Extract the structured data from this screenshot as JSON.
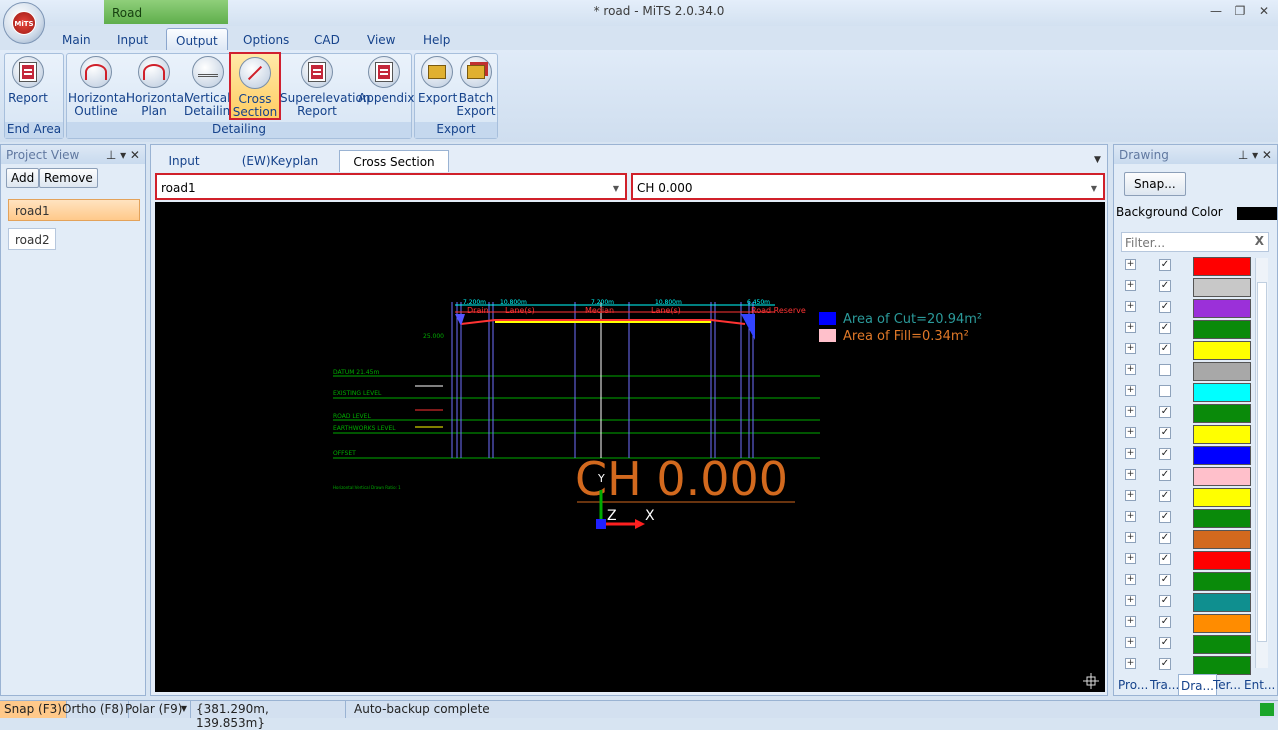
{
  "window": {
    "context_tab": "Road",
    "title": "* road - MiTS 2.0.34.0",
    "logo_text": "MiTS"
  },
  "menu": [
    "Main",
    "Input",
    "Output",
    "Options",
    "CAD",
    "View",
    "Help"
  ],
  "ribbon": {
    "groups": [
      "End Area",
      "Detailing",
      "Export"
    ],
    "buttons": [
      {
        "l1": "Report",
        "l2": ""
      },
      {
        "l1": "Horizontal",
        "l2": "Outline"
      },
      {
        "l1": "Horizontal",
        "l2": "Plan"
      },
      {
        "l1": "Vertical",
        "l2": "Detailing"
      },
      {
        "l1": "Cross",
        "l2": "Section"
      },
      {
        "l1": "Superelevation",
        "l2": "Report"
      },
      {
        "l1": "Appendix",
        "l2": ""
      },
      {
        "l1": "Export",
        "l2": ""
      },
      {
        "l1": "Batch",
        "l2": "Export"
      }
    ]
  },
  "project_view": {
    "title": "Project View",
    "add": "Add",
    "remove": "Remove",
    "items": [
      "road1",
      "road2"
    ]
  },
  "tabs": [
    "Input",
    "(EW)Keyplan",
    "Cross Section"
  ],
  "road_select": "road1",
  "chainage_select": "CH 0.000",
  "canvas": {
    "area_cut": "Area of Cut=20.94m²",
    "area_fill": "Area of Fill=0.34m²",
    "chainage": "CH 0.000",
    "datum": "DATUM 21.45m",
    "row_labels": [
      "EXISTING LEVEL",
      "ROAD LEVEL",
      "EARTHWORKS LEVEL",
      "OFFSET"
    ],
    "ratio": "Horizontal:Vertical Drawn Ratio: 1",
    "elev": "25.000",
    "dims": [
      "7.200m",
      "10.800m",
      "7.200m",
      "10.800m",
      "6.450m"
    ],
    "zones": [
      "Drain",
      "Lane(s)",
      "Median",
      "Lane(s)",
      "Road Reserve"
    ],
    "axis_y": "Y",
    "axis_z": "Z",
    "axis_x": "X"
  },
  "drawing": {
    "title": "Drawing",
    "snap": "Snap...",
    "bg_label": "Background Color",
    "filter_placeholder": "Filter...",
    "layers": [
      {
        "c": "#ff0000",
        "on": true
      },
      {
        "c": "#c8c8c8",
        "on": true
      },
      {
        "c": "#9b30d9",
        "on": true
      },
      {
        "c": "#0a8a0a",
        "on": true
      },
      {
        "c": "#ffff00",
        "on": true
      },
      {
        "c": "#a8a8a8",
        "on": false
      },
      {
        "c": "#00ffff",
        "on": false
      },
      {
        "c": "#0a8a0a",
        "on": true
      },
      {
        "c": "#ffff00",
        "on": true
      },
      {
        "c": "#0000ff",
        "on": true
      },
      {
        "c": "#ffc0cb",
        "on": true
      },
      {
        "c": "#ffff00",
        "on": true
      },
      {
        "c": "#0a8a0a",
        "on": true
      },
      {
        "c": "#d2691e",
        "on": true
      },
      {
        "c": "#ff0000",
        "on": true
      },
      {
        "c": "#0a8a0a",
        "on": true
      },
      {
        "c": "#0f8f8f",
        "on": true
      },
      {
        "c": "#ff8c00",
        "on": true
      },
      {
        "c": "#0a8a0a",
        "on": true
      },
      {
        "c": "#0a8a0a",
        "on": true
      }
    ],
    "bottom_tabs": [
      "Pro...",
      "Tra...",
      "Dra...",
      "Ter...",
      "Ent..."
    ]
  },
  "status": {
    "snap": "Snap (F3)",
    "ortho": "Ortho (F8)",
    "polar": "Polar (F9)",
    "coords": "{381.290m, 139.853m}",
    "message": "Auto-backup complete"
  }
}
